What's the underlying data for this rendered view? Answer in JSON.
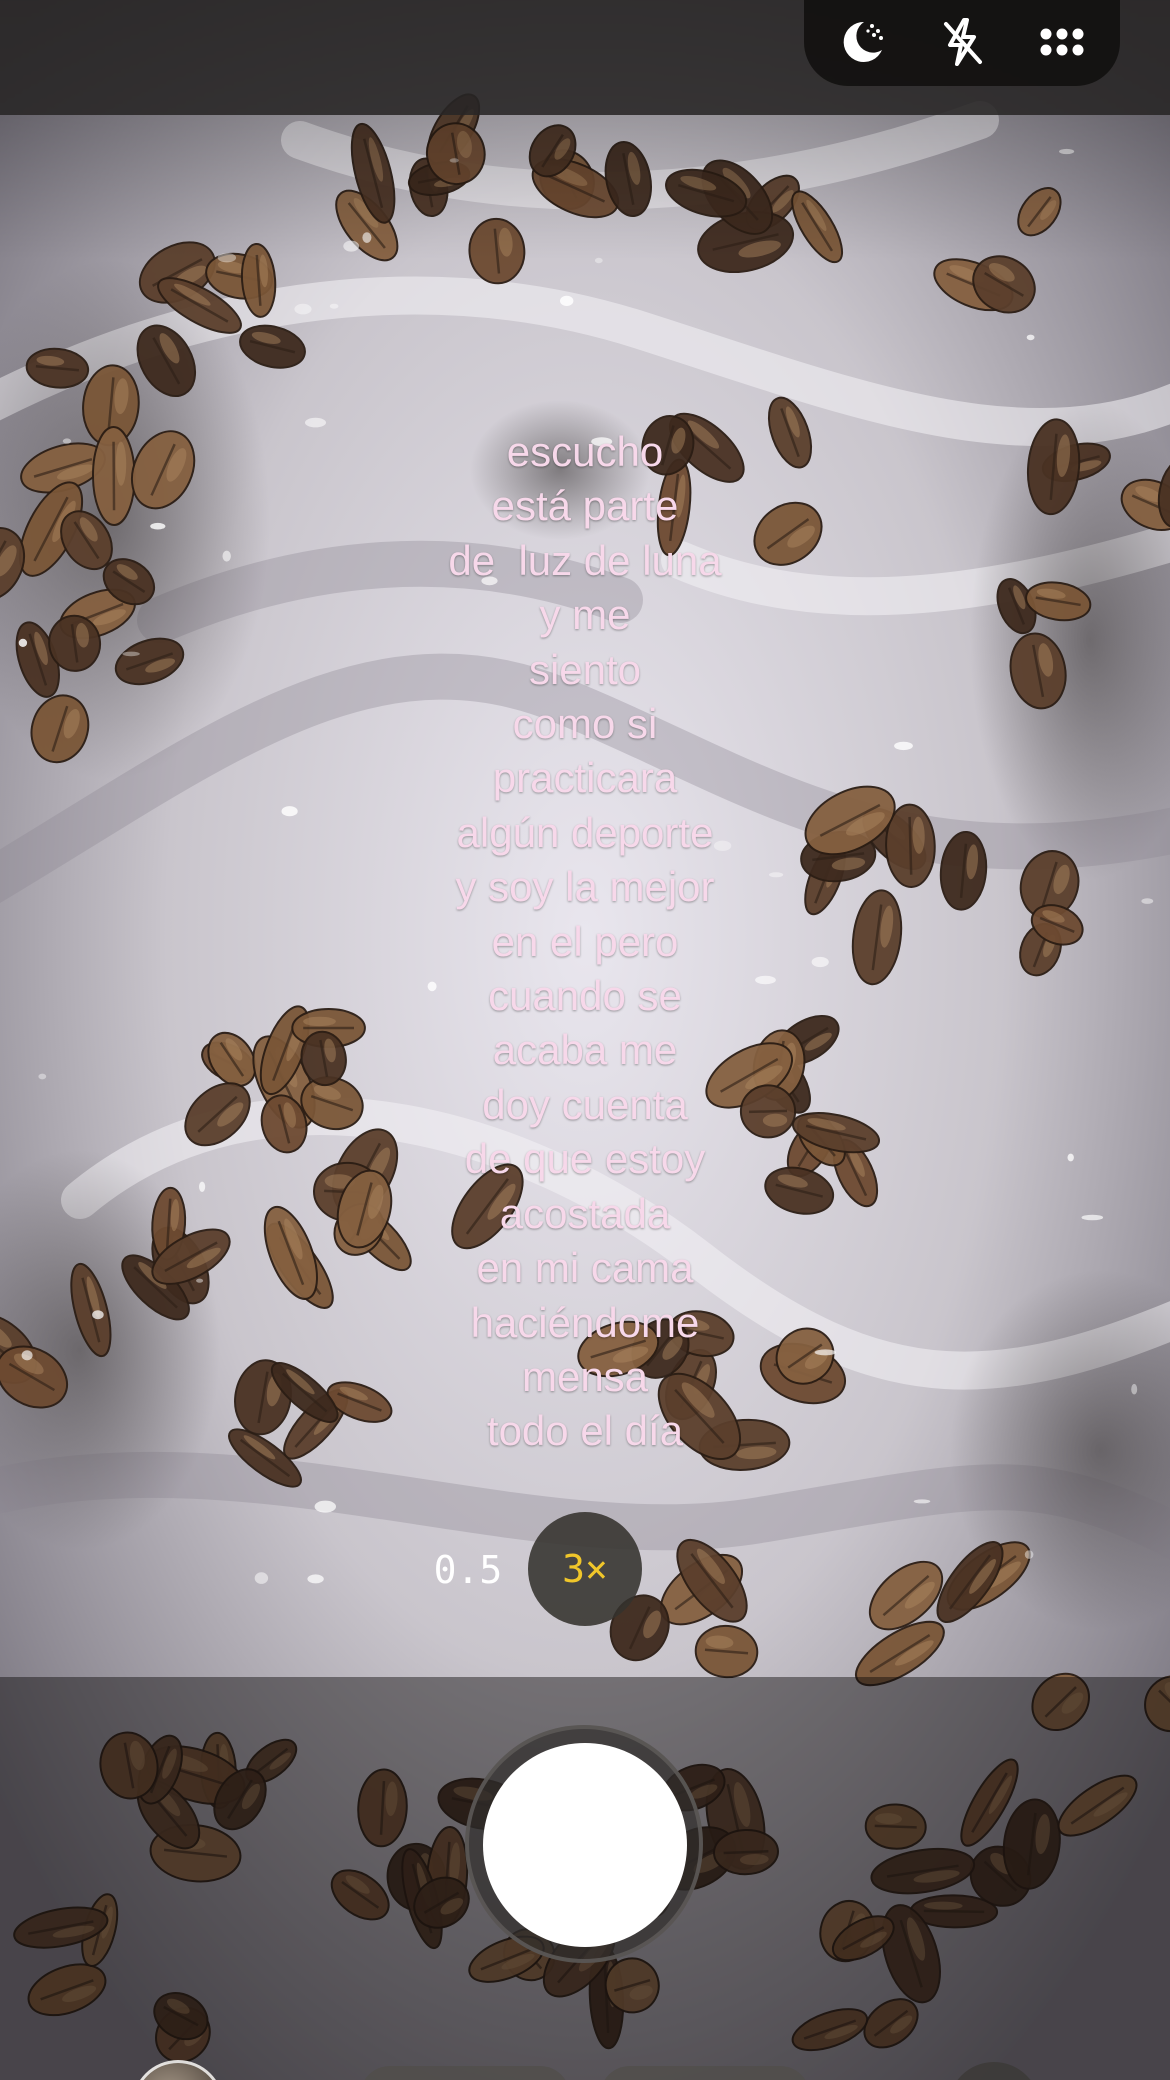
{
  "overlay_text": {
    "lines": [
      "escucho",
      "está parte",
      "de  luz de luna",
      "y me",
      "siento",
      "como si",
      "practicara",
      "algún deporte",
      "y soy la mejor",
      "en el pero",
      "cuando se",
      "acaba me",
      "doy cuenta",
      "de que estoy",
      "acostada",
      "en mi cama",
      "haciéndome",
      "mensa",
      "todo el día"
    ],
    "color": "#f7d8ea"
  },
  "top_controls": {
    "night_mode_icon": "moon-stars-icon",
    "flash_icon": "flash-off-icon",
    "more_icon": "grid-dots-icon"
  },
  "zoom": {
    "options": [
      "0.5",
      "3×"
    ],
    "selected": "3×",
    "active_color": "#f0c62a"
  }
}
